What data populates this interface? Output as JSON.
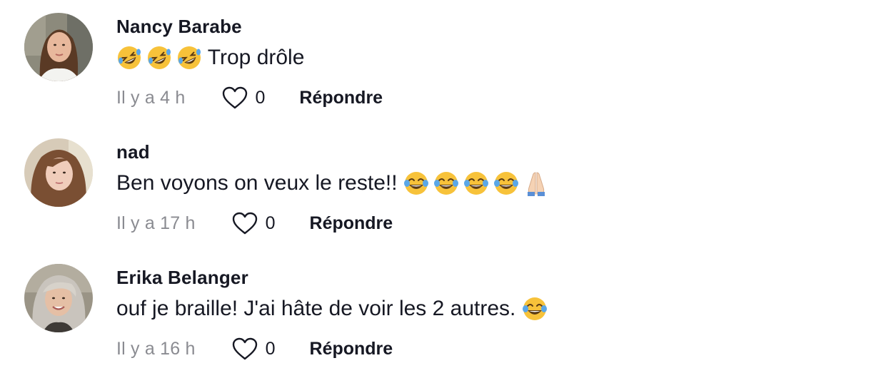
{
  "comments": [
    {
      "username": "Nancy Barabe",
      "emojis_before": [
        "rofl-emoji",
        "rofl-emoji",
        "rofl-emoji"
      ],
      "text": " Trop drôle",
      "emojis_after": [],
      "timestamp": "Il y a 4 h",
      "likes": "0",
      "reply_label": "Répondre",
      "like_icon": "heart-outline-icon"
    },
    {
      "username": "nad",
      "emojis_before": [],
      "text": "Ben voyons on veux le reste!! ",
      "emojis_after": [
        "tears-of-joy-emoji",
        "tears-of-joy-emoji",
        "tears-of-joy-emoji",
        "tears-of-joy-emoji",
        "folded-hands-emoji"
      ],
      "timestamp": "Il y a 17 h",
      "likes": "0",
      "reply_label": "Répondre",
      "like_icon": "heart-outline-icon"
    },
    {
      "username": "Erika Belanger",
      "emojis_before": [],
      "text": "ouf je braille! J'ai hâte de voir les 2 autres. ",
      "emojis_after": [
        "tears-of-joy-emoji"
      ],
      "timestamp": "Il y a 16 h",
      "likes": "0",
      "reply_label": "Répondre",
      "like_icon": "heart-outline-icon"
    }
  ],
  "colors": {
    "text_primary": "#161823",
    "text_secondary": "#8a8b91",
    "emoji_yellow": "#f7c23a"
  }
}
